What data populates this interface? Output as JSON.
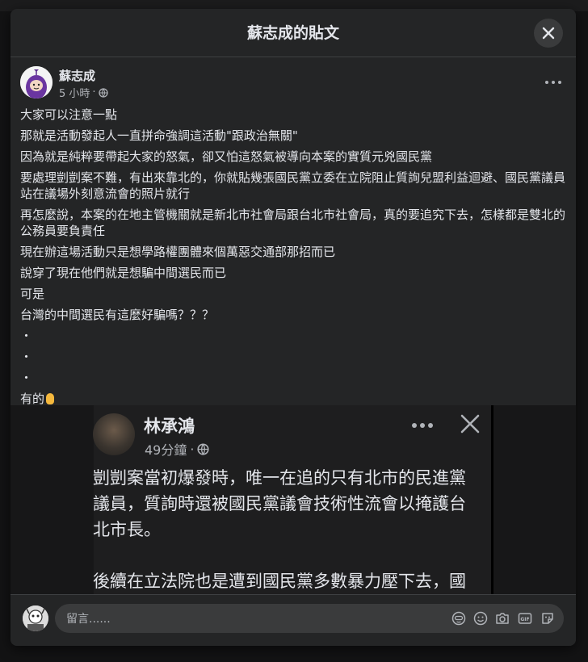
{
  "dialog": {
    "title": "蘇志成的貼文"
  },
  "post": {
    "author": "蘇志成",
    "time": "5 小時",
    "meta_separator": "·",
    "privacy_icon": "globe-icon",
    "lines": [
      "大家可以注意一點",
      "那就是活動發起人一直拼命強調這活動\"跟政治無關\"",
      "因為就是純粹要帶起大家的怒氣，卻又怕這怒氣被導向本案的實質元兇國民黨",
      "要處理剴剴案不難，有出來靠北的，你就貼幾張國民黨立委在立院阻止質詢兒盟利益迴避、國民黨議員站在議場外刻意流會的照片就行",
      "再怎麼說，本案的在地主管機關就是新北市社會局跟台北市社會局，真的要追究下去，怎樣都是雙北的公務員要負責任",
      "現在辦這場活動只是想學路權團體來個萬惡交通部那招而已",
      "說穿了現在他們就是想騙中間選民而已",
      "可是",
      "台灣的中間選民有這麼好騙嗎？？？",
      "・",
      "・",
      "・"
    ],
    "last_line": "有的",
    "last_line_emoji": "ok-hand-emoji"
  },
  "embedded_screenshot": {
    "author": "林承鴻",
    "time": "49分鐘",
    "meta_separator": "·",
    "paragraphs": [
      "剴剴案當初爆發時，唯一在追的只有北市的民進黨議員，質詢時還被國民黨議會技術性流會以掩護台北市長。",
      "後續在立法院也是遭到國民黨多數暴力壓下去，國"
    ]
  },
  "comment_box": {
    "placeholder": "留言......",
    "icons": [
      "avatar-sticker-icon",
      "emoji-icon",
      "camera-icon",
      "gif-icon",
      "sticker-icon"
    ]
  },
  "colors": {
    "background": "#131314",
    "dialog": "#242526",
    "text_primary": "#e4e6eb",
    "text_secondary": "#b0b3b8",
    "input": "#3a3b3c"
  }
}
